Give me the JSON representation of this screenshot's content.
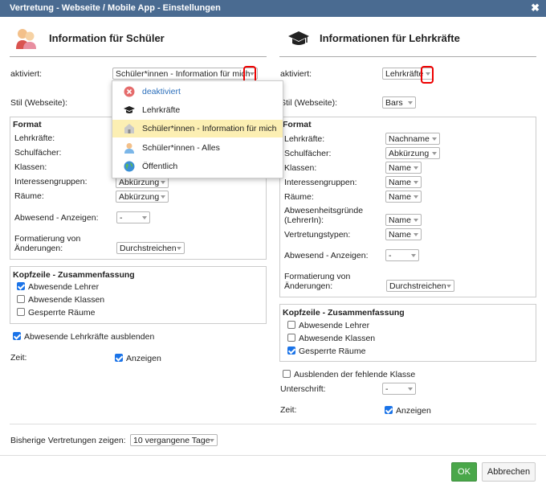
{
  "window": {
    "title": "Vertretung - Webseite / Mobile App - Einstellungen",
    "close": "✖"
  },
  "left": {
    "title": "Information für Schüler",
    "activated_label": "aktiviert:",
    "activated_value": "Schüler*innen - Information für mich",
    "style_label": "Stil (Webseite):",
    "format": {
      "title": "Format",
      "rows": [
        {
          "label": "Lehrkräfte:",
          "value": ""
        },
        {
          "label": "Schulfächer:",
          "value": ""
        },
        {
          "label": "Klassen:",
          "value": ""
        },
        {
          "label": "Interessengruppen:",
          "value": "Abkürzung"
        },
        {
          "label": "Räume:",
          "value": "Abkürzung"
        }
      ],
      "absent_label": "Abwesend - Anzeigen:",
      "absent_value": "-",
      "changes_label": "Formatierung von Änderungen:",
      "changes_value": "Durchstreichen"
    },
    "header_box": {
      "title": "Kopfzeile - Zusammenfassung",
      "items": [
        {
          "label": "Abwesende Lehrer",
          "checked": true
        },
        {
          "label": "Abwesende Klassen",
          "checked": false
        },
        {
          "label": "Gesperrte Räume",
          "checked": false
        }
      ]
    },
    "hide_absent": {
      "label": "Abwesende Lehrkräfte ausblenden",
      "checked": true
    },
    "time_label": "Zeit:",
    "time_show": {
      "label": "Anzeigen",
      "checked": true
    }
  },
  "dropdown": {
    "items": [
      {
        "label": "deaktiviert",
        "icon": "deactivated-icon",
        "color": "#2a6ebb"
      },
      {
        "label": "Lehrkräfte",
        "icon": "graduation-cap-icon",
        "color": "#222"
      },
      {
        "label": "Schüler*innen - Information für mich",
        "icon": "school-house-icon",
        "color": "#222",
        "selected": true
      },
      {
        "label": "Schüler*innen - Alles",
        "icon": "student-icon",
        "color": "#222"
      },
      {
        "label": "Öffentlich",
        "icon": "globe-icon",
        "color": "#222"
      }
    ]
  },
  "right": {
    "title": "Informationen für Lehrkräfte",
    "activated_label": "aktiviert:",
    "activated_value": "Lehrkräfte",
    "style_label": "Stil (Webseite):",
    "style_value": "Bars",
    "format": {
      "title": "Format",
      "rows": [
        {
          "label": "Lehrkräfte:",
          "value": "Nachname"
        },
        {
          "label": "Schulfächer:",
          "value": "Abkürzung"
        },
        {
          "label": "Klassen:",
          "value": "Name"
        },
        {
          "label": "Interessengruppen:",
          "value": "Name"
        },
        {
          "label": "Räume:",
          "value": "Name"
        },
        {
          "label": "Abwesenheitsgründe (LehrerIn):",
          "value": "Name"
        },
        {
          "label": "Vertretungstypen:",
          "value": "Name"
        }
      ],
      "absent_label": "Abwesend - Anzeigen:",
      "absent_value": "-",
      "changes_label": "Formatierung von Änderungen:",
      "changes_value": "Durchstreichen"
    },
    "header_box": {
      "title": "Kopfzeile - Zusammenfassung",
      "items": [
        {
          "label": "Abwesende Lehrer",
          "checked": false
        },
        {
          "label": "Abwesende Klassen",
          "checked": false
        },
        {
          "label": "Gesperrte Räume",
          "checked": true
        }
      ]
    },
    "hide_missing": {
      "label": "Ausblenden der fehlende Klasse",
      "checked": false
    },
    "signature_label": "Unterschrift:",
    "signature_value": "-",
    "time_label": "Zeit:",
    "time_show": {
      "label": "Anzeigen",
      "checked": true
    }
  },
  "bottom": {
    "previous_label": "Bisherige Vertretungen zeigen:",
    "previous_value": "10 vergangene Tage"
  },
  "buttons": {
    "ok": "OK",
    "cancel": "Abbrechen"
  },
  "colors": {
    "titlebar": "#4a6b91",
    "ok": "#4aa74a",
    "highlight": "#fcefb3",
    "checkbox": "#1a73e8",
    "marker": "#e00000"
  }
}
